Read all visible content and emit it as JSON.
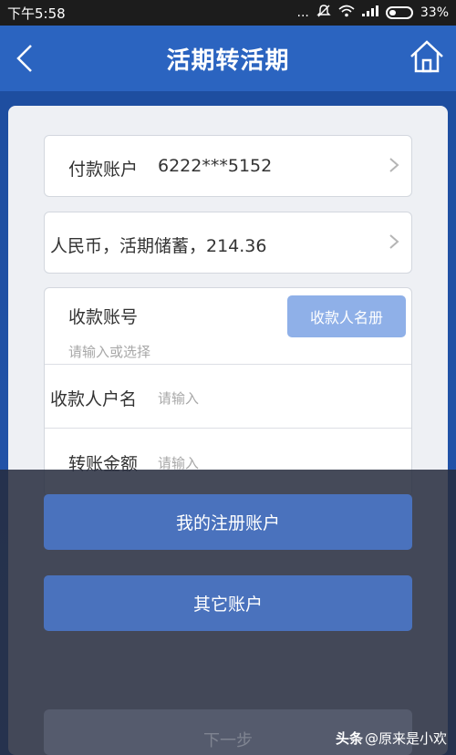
{
  "status_bar": {
    "time": "下午5:58",
    "signal": "...",
    "battery": "33%"
  },
  "header": {
    "title": "活期转活期",
    "back_icon": "chevron-left-icon",
    "home_icon": "home-icon"
  },
  "account_field": {
    "label": "付款账户",
    "value": "6222***5152"
  },
  "balance_field": {
    "value": "人民币，活期储蓄，214.36"
  },
  "payee": {
    "account_label": "收款账号",
    "account_placeholder": "请输入或选择",
    "directory_button": "收款人名册",
    "name_label": "收款人户名",
    "name_placeholder": "请输入",
    "amount_label": "转账金额",
    "amount_placeholder": "请输入"
  },
  "sheet": {
    "my_accounts_button": "我的注册账户",
    "other_accounts_button": "其它账户"
  },
  "next_button": "下一步",
  "watermark": {
    "logo": "头条",
    "handle": "@原来是小欢"
  },
  "colors": {
    "header": "#2b64c0",
    "primary_button": "#4a72bd",
    "directory_button": "#8fb0e8"
  }
}
